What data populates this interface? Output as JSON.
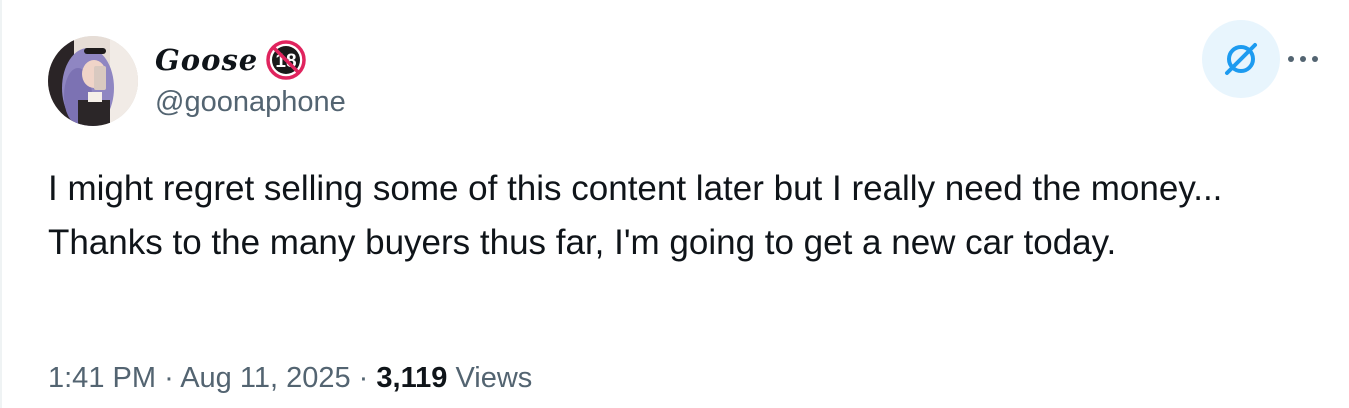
{
  "author": {
    "display_name": "Goose",
    "badge_icon": "age-18-restricted-icon",
    "handle": "@goonaphone"
  },
  "actions": {
    "grok_icon": "grok-slash-icon",
    "more_icon": "more-dots-icon"
  },
  "tweet": {
    "text": "I might regret selling some of this content later but I really need the money... Thanks to the many buyers thus far, I'm going to get a new car today."
  },
  "meta": {
    "time": "1:41 PM",
    "separator": "·",
    "date": "Aug 11, 2025",
    "views_count": "3,119",
    "views_label": "Views"
  },
  "colors": {
    "text": "#0f1419",
    "secondary_text": "#536471",
    "accent": "#1d9bf0",
    "grok_bg": "#e8f5fd",
    "badge_red": "#e0245e"
  }
}
